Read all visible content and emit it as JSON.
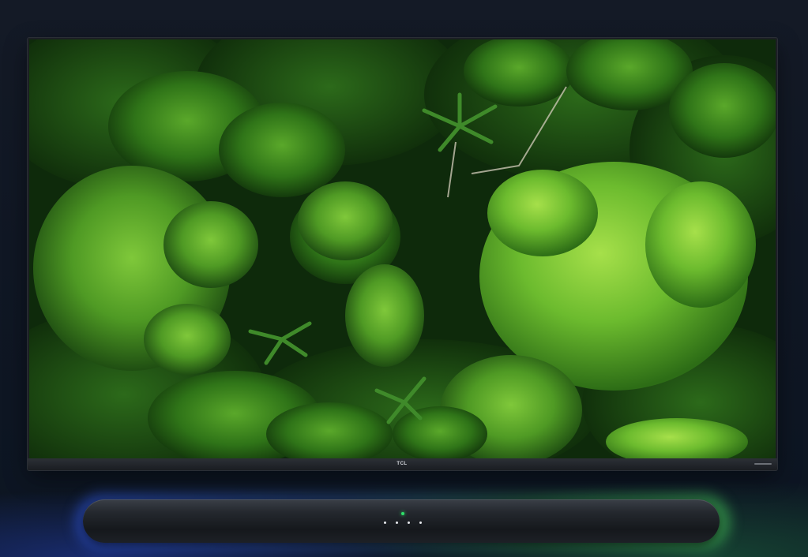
{
  "tv": {
    "brand_logo": "TCL",
    "screen_content_icon": "rainforest-canopy-image"
  },
  "soundbar": {
    "status_led_color": "#2fe06a",
    "indicator_dot_count": 4
  },
  "colors": {
    "background": "#111827",
    "glow_blue": "#3a5ae6",
    "glow_green": "#46c85a"
  }
}
